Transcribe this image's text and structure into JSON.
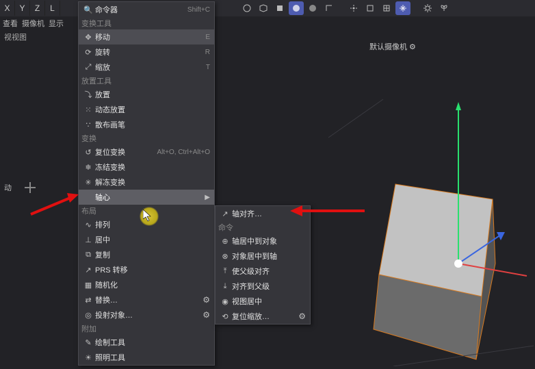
{
  "axes": {
    "x": "X",
    "y": "Y",
    "z": "Z",
    "l": "L"
  },
  "secbar": {
    "a": "查看",
    "b": "摄像机",
    "c": "显示"
  },
  "sec_title": "视视图",
  "secbar_f": "动",
  "viewport_label": "默认摄像机 ⚙",
  "menu": {
    "top": {
      "search": "命令器",
      "search_sc": "Shift+C"
    },
    "h_transform": "变换工具",
    "move": "移动",
    "move_sc": "E",
    "rotate": "旋转",
    "rotate_sc": "R",
    "scale": "缩放",
    "scale_sc": "T",
    "h_place": "放置工具",
    "place": "放置",
    "dyn_place": "动态放置",
    "scatter": "散布画笔",
    "h_transform2": "变换",
    "reset": "复位变换",
    "reset_sc": "Alt+O, Ctrl+Alt+O",
    "freeze": "冻结变换",
    "unfreeze": "解冻变换",
    "axis": "轴心",
    "h_layout": "布局",
    "arrange": "排列",
    "center": "居中",
    "duplicate": "复制",
    "prs": "PRS 转移",
    "random": "随机化",
    "replace": "替换…",
    "project": "投射对象…",
    "h_attach": "附加",
    "drawtool": "绘制工具",
    "lighttool": "照明工具"
  },
  "submenu": {
    "align_axis": "轴对齐…",
    "h_cmd": "命令",
    "axis_center_obj": "轴居中到对象",
    "obj_center_axis": "对象居中到轴",
    "parent_align": "使父级对齐",
    "align_to_parent": "对齐到父级",
    "view_center": "视图居中",
    "reset_scale": "复位缩放…"
  }
}
